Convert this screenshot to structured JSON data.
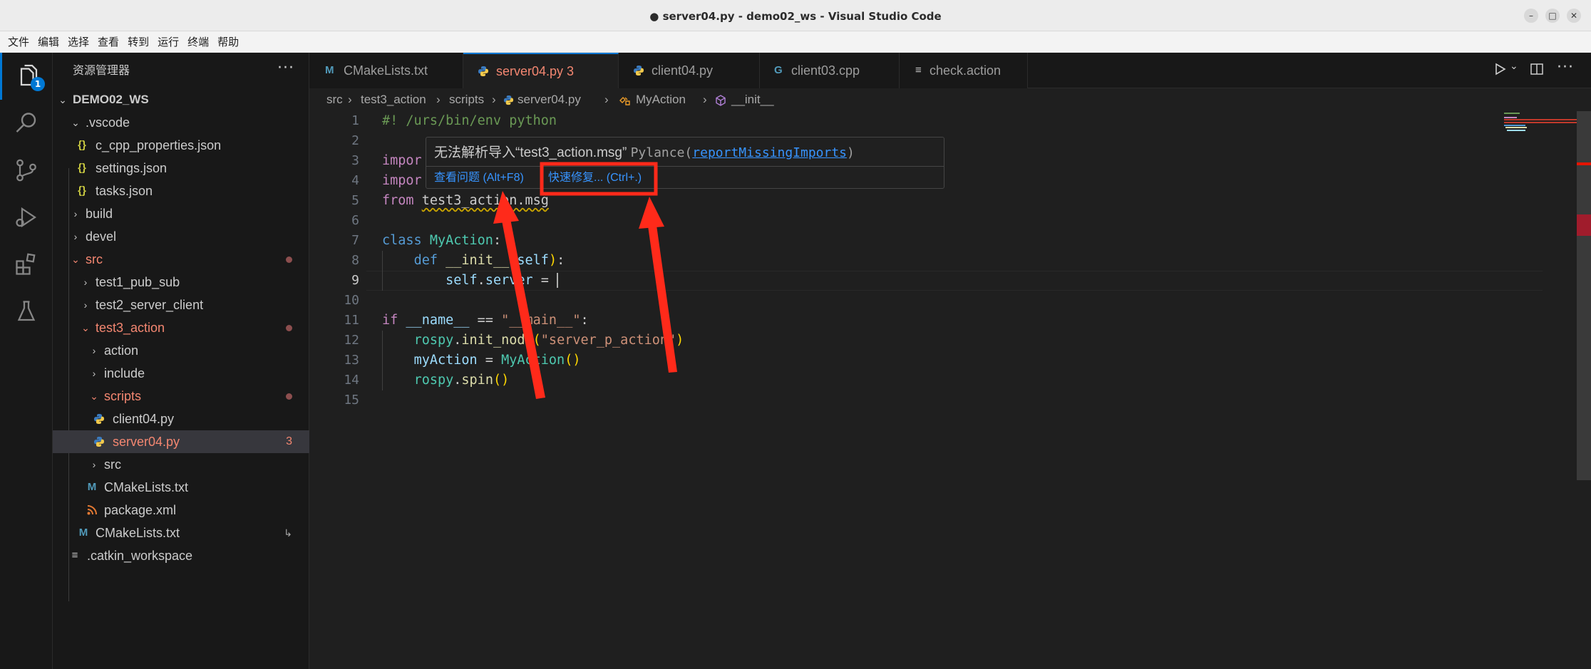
{
  "window": {
    "title": "● server04.py - demo02_ws - Visual Studio Code",
    "controls": [
      "–",
      "□",
      "✕"
    ]
  },
  "menu": [
    "文件",
    "编辑",
    "选择",
    "查看",
    "转到",
    "运行",
    "终端",
    "帮助"
  ],
  "activity_bar": {
    "items": [
      "explorer-icon",
      "search-icon",
      "source-control-icon",
      "run-debug-icon",
      "extensions-icon",
      "testing-icon"
    ],
    "explorer_badge": "1"
  },
  "explorer": {
    "title": "资源管理器",
    "more": "···",
    "tree": [
      {
        "label": "DEMO02_WS",
        "chev": "⌄"
      },
      {
        "label": ".vscode",
        "chev": "⌄"
      },
      {
        "label": "c_cpp_properties.json",
        "icon": "{}"
      },
      {
        "label": "settings.json",
        "icon": "{}"
      },
      {
        "label": "tasks.json",
        "icon": "{}"
      },
      {
        "label": "build",
        "chev": "›"
      },
      {
        "label": "devel",
        "chev": "›"
      },
      {
        "label": "src",
        "chev": "⌄"
      },
      {
        "label": "test1_pub_sub",
        "chev": "›"
      },
      {
        "label": "test2_server_client",
        "chev": "›"
      },
      {
        "label": "test3_action",
        "chev": "⌄"
      },
      {
        "label": "action",
        "chev": "›"
      },
      {
        "label": "include",
        "chev": "›"
      },
      {
        "label": "scripts",
        "chev": "⌄"
      },
      {
        "label": "client04.py"
      },
      {
        "label": "server04.py",
        "count": "3"
      },
      {
        "label": "src",
        "chev": "›"
      },
      {
        "label": "CMakeLists.txt",
        "icon": "M"
      },
      {
        "label": "package.xml",
        "icon": "rss"
      },
      {
        "label": "CMakeLists.txt",
        "icon": "M",
        "trailing": "↳"
      },
      {
        "label": ".catkin_workspace",
        "icon": "≡"
      }
    ]
  },
  "tabs": [
    {
      "label": "CMakeLists.txt",
      "icon": "M"
    },
    {
      "label": "server04.py 3",
      "icon": "py",
      "active": true
    },
    {
      "label": "client04.py",
      "icon": "py"
    },
    {
      "label": "client03.cpp",
      "icon": "G"
    },
    {
      "label": "check.action",
      "icon": "≡"
    }
  ],
  "breadcrumb": {
    "parts": [
      "src",
      "test3_action",
      "scripts",
      "server04.py",
      "MyAction",
      "__init__"
    ],
    "sep": "›"
  },
  "editor": {
    "line_numbers": [
      "1",
      "2",
      "3",
      "4",
      "5",
      "6",
      "7",
      "8",
      "9",
      "10",
      "11",
      "12",
      "13",
      "14",
      "15"
    ],
    "current_line": "9"
  },
  "hover": {
    "message": "无法解析导入“test3_action.msg”",
    "source": "Pylance(",
    "rule": "reportMissingImports",
    "close_paren": ")",
    "action_view_problem": "查看问题 (Alt+F8)",
    "action_quick_fix": "快速修复... (Ctrl+.)"
  },
  "colors": {
    "accent": "#0078d4",
    "error": "#f48771",
    "annotation_red": "#ff2a1a",
    "link": "#3794ff"
  }
}
